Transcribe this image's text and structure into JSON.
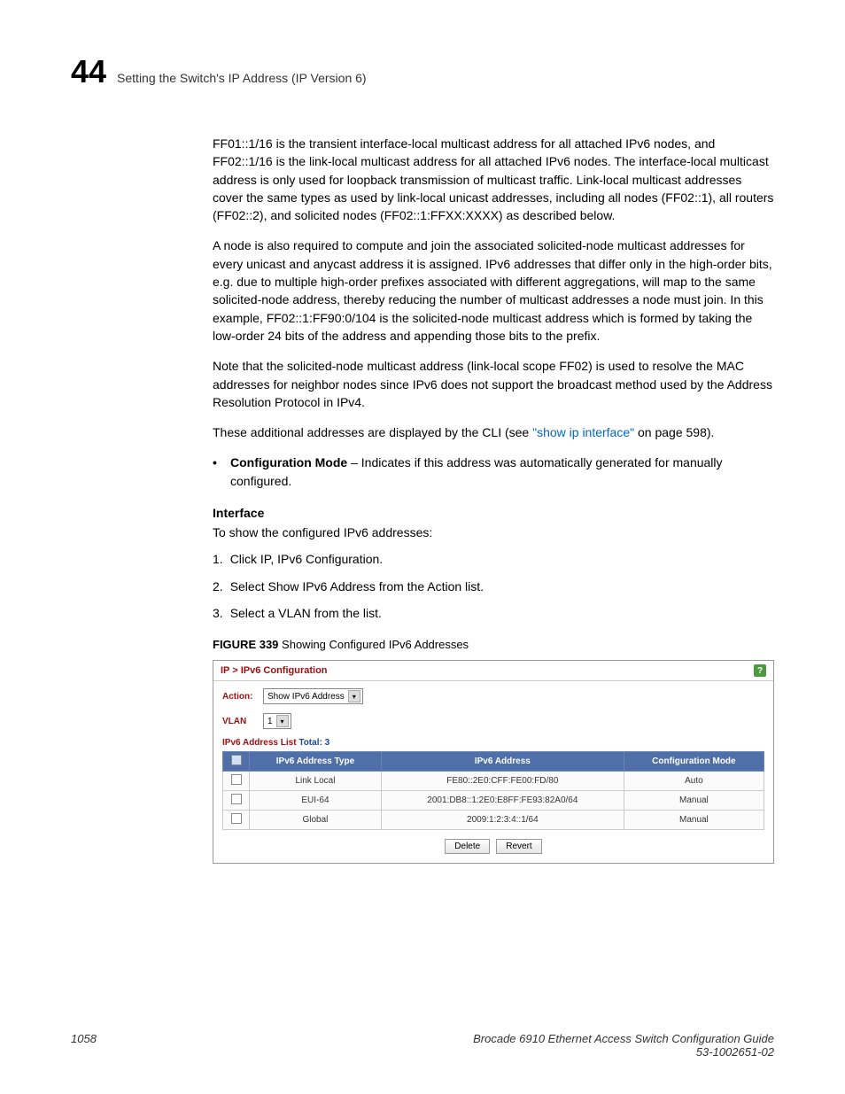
{
  "header": {
    "chapter": "44",
    "title": "Setting the Switch's IP Address (IP Version 6)"
  },
  "paragraphs": {
    "p1": "FF01::1/16 is the transient interface-local multicast address for all attached IPv6 nodes, and FF02::1/16 is the link-local multicast address for all attached IPv6 nodes. The interface-local multicast address is only used for loopback transmission of multicast traffic. Link-local multicast addresses cover the same types as used by link-local unicast addresses, including all nodes (FF02::1), all routers (FF02::2), and solicited nodes (FF02::1:FFXX:XXXX) as described below.",
    "p2": "A node is also required to compute and join the associated solicited-node multicast addresses for every unicast and anycast address it is assigned. IPv6 addresses that differ only in the high-order bits, e.g. due to multiple high-order prefixes associated with different aggregations, will map to the same solicited-node address, thereby reducing the number of multicast addresses a node must join. In this example, FF02::1:FF90:0/104 is the solicited-node multicast address which is formed by taking the low-order 24 bits of the address and appending those bits to the prefix.",
    "p3": "Note that the solicited-node multicast address (link-local scope FF02) is used to resolve the MAC addresses for neighbor nodes since IPv6 does not support the broadcast method used by the Address Resolution Protocol in IPv4.",
    "p4_a": "These additional addresses are displayed by the CLI (see ",
    "p4_link": "\"show ip interface\"",
    "p4_b": " on page 598).",
    "bullet_label": "Configuration Mode",
    "bullet_text": " – Indicates if this address was automatically generated for manually configured."
  },
  "interface": {
    "heading": "Interface",
    "intro": "To show the configured IPv6 addresses:",
    "steps": {
      "s1n": "1.",
      "s1": "Click IP, IPv6 Configuration.",
      "s2n": "2.",
      "s2": "Select Show IPv6 Address from the Action list.",
      "s3n": "3.",
      "s3": "Select a VLAN from the list."
    }
  },
  "figure": {
    "label": "FIGURE 339",
    "caption": "Showing Configured IPv6 Addresses"
  },
  "panel": {
    "breadcrumb": "IP > IPv6 Configuration",
    "action_label": "Action:",
    "action_value": "Show IPv6 Address",
    "vlan_label": "VLAN",
    "vlan_value": "1",
    "list_title": "IPv6 Address List  ",
    "total_label": "Total: 3",
    "columns": {
      "c1": "IPv6 Address Type",
      "c2": "IPv6 Address",
      "c3": "Configuration Mode"
    },
    "rows": [
      {
        "type": "Link Local",
        "addr": "FE80::2E0:CFF:FE00:FD/80",
        "mode": "Auto"
      },
      {
        "type": "EUI-64",
        "addr": "2001:DB8::1:2E0:E8FF:FE93:82A0/64",
        "mode": "Manual"
      },
      {
        "type": "Global",
        "addr": "2009:1:2:3:4::1/64",
        "mode": "Manual"
      }
    ],
    "buttons": {
      "delete": "Delete",
      "revert": "Revert"
    }
  },
  "footer": {
    "page": "1058",
    "title": "Brocade 6910 Ethernet Access Switch Configuration Guide",
    "docnum": "53-1002651-02"
  }
}
